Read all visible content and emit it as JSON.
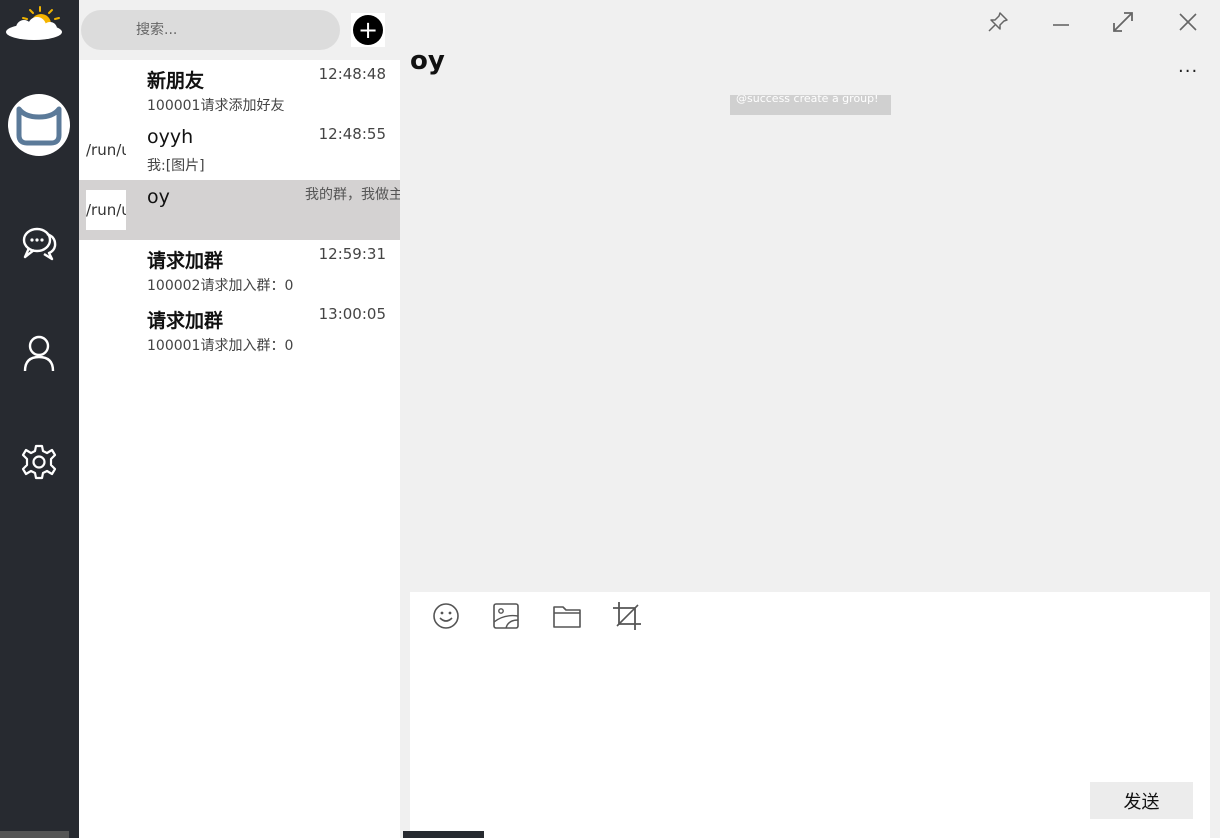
{
  "sidebar": {
    "logo_icon": "weather-sun-cloud-icon",
    "avatar_icon": "avatar-face-icon",
    "nav": [
      {
        "icon": "chat-bubbles-icon"
      },
      {
        "icon": "user-icon"
      },
      {
        "icon": "gear-icon"
      }
    ]
  },
  "search": {
    "placeholder": "搜索..."
  },
  "add_button": {
    "icon": "plus-icon",
    "glyph": "+"
  },
  "conversations": [
    {
      "name": "新朋友",
      "time": "12:48:48",
      "preview": "100001请求添加好友",
      "thumb_text": ""
    },
    {
      "name": "oyyh",
      "time": "12:48:55",
      "preview": "我:[图片]",
      "thumb_text": "/run/user"
    },
    {
      "name": "oy",
      "time": "",
      "preview": "",
      "thumb_text": "/run/user",
      "overflow_text": "我的群，我做主"
    },
    {
      "name": "请求加群",
      "time": "12:59:31",
      "preview": "100002请求加入群：0",
      "thumb_text": ""
    },
    {
      "name": "请求加群",
      "time": "13:00:05",
      "preview": "100001请求加入群：0",
      "thumb_text": ""
    }
  ],
  "chat": {
    "title": "oy",
    "more_label": "...",
    "notice": "@success create a group!"
  },
  "window_controls": [
    "pin-icon",
    "minimize-icon",
    "maximize-icon",
    "close-icon"
  ],
  "composer": {
    "tools": [
      "emoji-icon",
      "image-icon",
      "folder-icon",
      "crop-icon"
    ],
    "send_label": "发送"
  },
  "colors": {
    "sidebar": "#272a30",
    "list_bg": "#ffffff",
    "active_row": "#d4d2d2",
    "chat_bg": "#f0f0f0",
    "avatar_accent": "#5b7a99"
  }
}
